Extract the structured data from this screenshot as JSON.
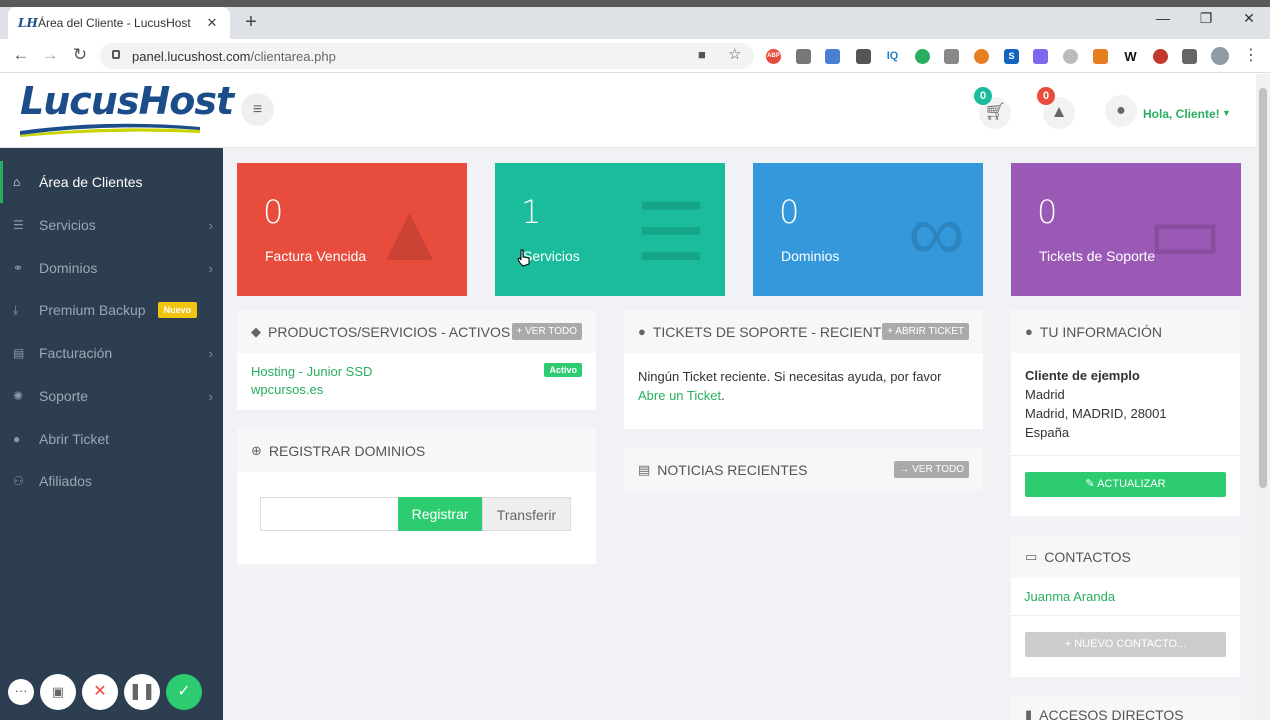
{
  "browser": {
    "tab_favicon": "LH",
    "tab_title": "Área del Cliente - LucusHost",
    "new_tab": "+",
    "url_host": "panel.lucushost.com",
    "url_path": "/clientarea.php",
    "window": {
      "minimize": "—",
      "maximize": "❐",
      "close": "✕"
    }
  },
  "header": {
    "logo_text": "LucusHost",
    "cart_count": "0",
    "alerts_count": "0",
    "greeting": "Hola, Cliente!"
  },
  "sidebar": {
    "items": [
      {
        "label": "Área de Clientes",
        "icon": "home-icon",
        "glyph": "⌂"
      },
      {
        "label": "Servicios",
        "icon": "list-icon",
        "glyph": "☰"
      },
      {
        "label": "Dominios",
        "icon": "link-icon",
        "glyph": "⚭"
      },
      {
        "label": "Premium Backup",
        "icon": "download-icon",
        "glyph": "⤓",
        "badge": "Nuevo"
      },
      {
        "label": "Facturación",
        "icon": "money-icon",
        "glyph": "▤"
      },
      {
        "label": "Soporte",
        "icon": "support-icon",
        "glyph": "✺"
      },
      {
        "label": "Abrir Ticket",
        "icon": "comment-icon",
        "glyph": "●"
      },
      {
        "label": "Afiliados",
        "icon": "users-icon",
        "glyph": "⚇"
      }
    ]
  },
  "stats": [
    {
      "value": "0",
      "label": "Factura Vencida",
      "color": "#e74c3c",
      "icon": "warning-icon"
    },
    {
      "value": "1",
      "label": "Servicios",
      "color": "#1abc9c",
      "icon": "list-icon"
    },
    {
      "value": "0",
      "label": "Dominios",
      "color": "#3498db",
      "icon": "link-icon"
    },
    {
      "value": "0",
      "label": "Tickets de Soporte",
      "color": "#9b59b6",
      "icon": "inbox-icon"
    }
  ],
  "products": {
    "title": "Productos/Servicios - Activos",
    "button": "Ver Todo",
    "item_name": "Hosting - Junior SSD",
    "item_domain": "wpcursos.es",
    "item_status": "Activo"
  },
  "domains": {
    "title": "Registrar Dominios",
    "input_placeholder": "",
    "register": "Registrar",
    "transfer": "Transferir"
  },
  "tickets": {
    "title": "Tickets de Soporte - Recientes",
    "button": "Abrir Ticket",
    "empty_text": "Ningún Ticket reciente. Si necesitas ayuda, por favor",
    "empty_link": "Abre un Ticket",
    "empty_end": "."
  },
  "news": {
    "title": "Noticias Recientes",
    "button": "Ver Todo"
  },
  "info": {
    "title": "Tu Información",
    "name": "Cliente de ejemplo",
    "line1": "Madrid",
    "line2": "Madrid, MADRID, 28001",
    "line3": "España",
    "update": "Actualizar"
  },
  "contacts": {
    "title": "Contactos",
    "contact": "Juanma Aranda",
    "new_contact": "Nuevo Contacto..."
  },
  "shortcuts": {
    "title": "Accesos Directos"
  },
  "colors": {
    "brand_blue": "#1b4d8a",
    "green": "#2ecc71",
    "sidebar": "#2c3e50",
    "cart_badge": "#1abc9c",
    "alert_badge": "#e74c3c"
  }
}
